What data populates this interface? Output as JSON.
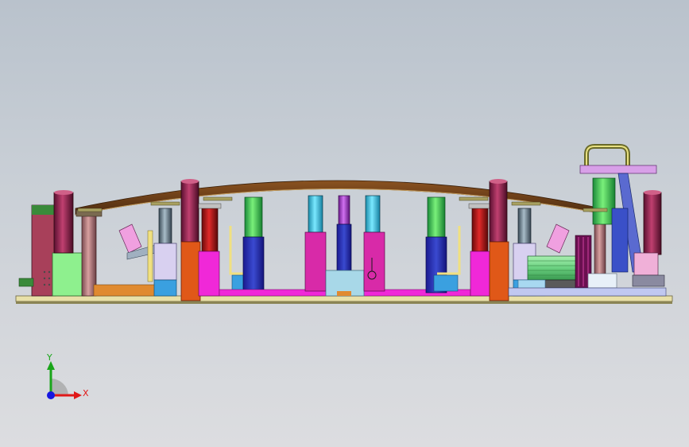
{
  "viewport": {
    "background_top": "#b9c2cc",
    "background_bottom": "#dcdde0"
  },
  "triad": {
    "x_label": "X",
    "y_label": "Y",
    "x_color": "#e01818",
    "y_color": "#1aa51a",
    "origin_color": "#1616e0"
  },
  "model": {
    "icon": "press-fixture-assembly-icon"
  }
}
